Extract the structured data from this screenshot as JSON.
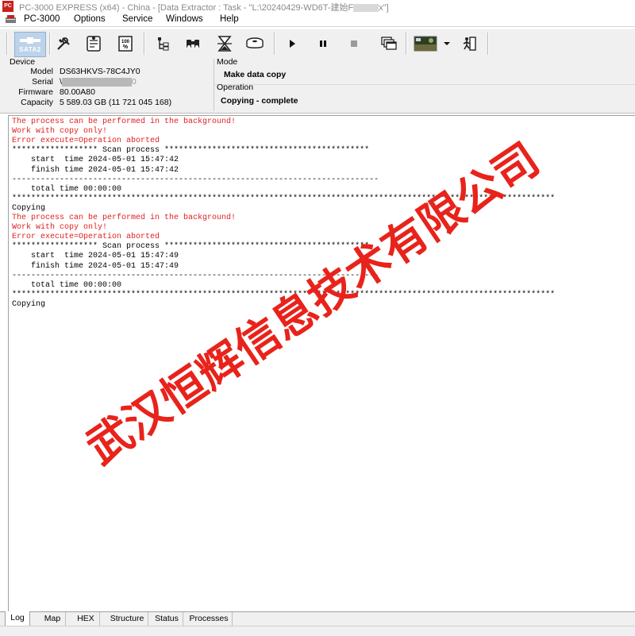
{
  "window": {
    "title_prefix": "PC-3000 EXPRESS (x64) - China - [Data Extractor : Task - \"L:\\20240429-WD6T-建始F",
    "title_suffix": "x\"]",
    "app_icon_text": "PC"
  },
  "menu": {
    "app_label": "PC-3000",
    "items": [
      "Options",
      "Service",
      "Windows",
      "Help"
    ]
  },
  "toolbar": {
    "sata_label": "SATA2",
    "buttons": [
      "tools-icon",
      "document-icon",
      "percent-icon",
      "tree-icon",
      "binoculars-icon",
      "hourglass-icon",
      "disk-icon",
      "play-icon",
      "pause-icon",
      "stop-icon",
      "windows-icon",
      "image-icon",
      "dropdown-icon",
      "exit-icon"
    ]
  },
  "device": {
    "heading": "Device",
    "model_label": "Model",
    "model": "DS63HKVS-78C4JY0",
    "serial_label": "Serial",
    "serial_prefix": "\\",
    "serial_suffix": "0",
    "firmware_label": "Firmware",
    "firmware": "80.00A80",
    "capacity_label": "Capacity",
    "capacity": "5 589.03 GB (11 721 045 168)"
  },
  "mode": {
    "heading": "Mode",
    "value": "Make data copy"
  },
  "operation": {
    "heading": "Operation",
    "value": "Copying - complete"
  },
  "log": {
    "lines": [
      {
        "text": "The process can be performed in the background!",
        "red": true
      },
      {
        "text": "Work with copy only!",
        "red": true
      },
      {
        "text": "Error execute=Operation aborted",
        "red": true
      },
      {
        "text": "****************** Scan process *******************************************",
        "red": false
      },
      {
        "text": "    start  time 2024-05-01 15:47:42",
        "red": false
      },
      {
        "text": "    finish time 2024-05-01 15:47:42",
        "red": false
      },
      {
        "text": "-----------------------------------------------------------------------------",
        "red": false
      },
      {
        "text": "    total time 00:00:00",
        "red": false
      },
      {
        "text": "******************************************************************************************************************",
        "red": false
      },
      {
        "text": "Copying",
        "red": false
      },
      {
        "text": "The process can be performed in the background!",
        "red": true
      },
      {
        "text": "Work with copy only!",
        "red": true
      },
      {
        "text": "Error execute=Operation aborted",
        "red": true
      },
      {
        "text": "****************** Scan process *******************************************",
        "red": false
      },
      {
        "text": "    start  time 2024-05-01 15:47:49",
        "red": false
      },
      {
        "text": "    finish time 2024-05-01 15:47:49",
        "red": false
      },
      {
        "text": "-----------------------------------------------------------------------------",
        "red": false
      },
      {
        "text": "    total time 00:00:00",
        "red": false
      },
      {
        "text": "******************************************************************************************************************",
        "red": false
      },
      {
        "text": "Copying",
        "red": false
      }
    ]
  },
  "watermark": {
    "text": "武汉恒辉信息技术有限公司",
    "color": "#e8231b"
  },
  "tabs": {
    "items": [
      "Log",
      "Map",
      "HEX",
      "Structure",
      "Status",
      "Processes"
    ],
    "active": "Log"
  }
}
